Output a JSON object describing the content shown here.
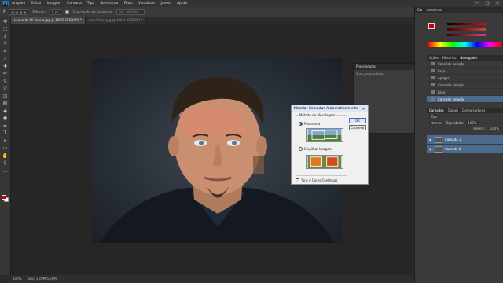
{
  "app": {
    "logo": "Ps"
  },
  "menu": [
    "Arquivo",
    "Editar",
    "Imagem",
    "Camada",
    "Tipo",
    "Selecionar",
    "Filtro",
    "Visualizar",
    "Janela",
    "Ajuda"
  ],
  "options_bar": {
    "mode_label": "Difusão:",
    "mode_value": "0 px",
    "checkbox_label": "Suavização de Serrilhado",
    "style_value": "Ref. de Estilo..."
  },
  "tabs": [
    {
      "label": "Leonardo Di Caprio.jpg @ 100% (RGB/8*) *",
      "active": true
    },
    {
      "label": "Sean Penn.jpg @ 100% (RGB/8*) *",
      "active": false
    }
  ],
  "properties_panel": {
    "title": "Propriedades",
    "body": "Sem propriedades"
  },
  "dialog": {
    "title": "Mesclar Camadas Automaticamente",
    "group_label": "Método de Mesclagem",
    "option1": "Panorama",
    "option2": "Empilhar Imagens",
    "ok": "OK",
    "cancel": "Cancelar",
    "checkbox_label": "Tons e Cores Contínuas"
  },
  "right_panels": {
    "color_tabs": [
      "Cor",
      "Amostras"
    ],
    "history_tabs": [
      "Ações",
      "Histórico",
      "Navegador"
    ],
    "history_items": [
      "Cancelar seleção",
      "Laço",
      "Apagar",
      "Cancelar seleção",
      "Laço",
      "Cancelar seleção"
    ],
    "layers_tabs": [
      "Camadas",
      "Canais",
      "Demarcadores"
    ],
    "layers_kind": "Tipo",
    "layers_mode": "Normal",
    "opacity_label": "Opacidade:",
    "opacity_value": "100%",
    "fill_label": "Preenc.:",
    "fill_value": "100%",
    "layers": [
      {
        "name": "Camada 1",
        "selected": true
      },
      {
        "name": "Camada 0",
        "selected": true
      }
    ]
  },
  "status": {
    "zoom": "100%",
    "doc": "Doc: 1,19M/5,20M"
  },
  "colors": {
    "accent": "#4b6a8c",
    "foreground": "#cc0000",
    "background": "#ffffff"
  }
}
